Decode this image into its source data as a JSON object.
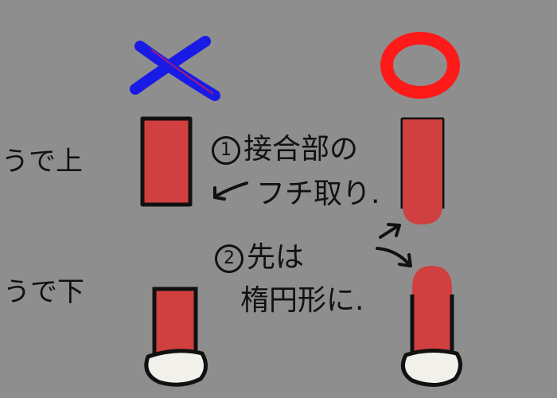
{
  "labels": {
    "upper_arm": "うで上",
    "lower_arm": "うで下"
  },
  "notes": {
    "note1": {
      "number": "1",
      "line1": "接合部の",
      "line2": "フチ取り."
    },
    "note2": {
      "number": "2",
      "line1": "先は",
      "line2": "楕円形に."
    }
  },
  "colors": {
    "background": "#8e8e8e",
    "arm_red": "#d04040",
    "cuff_white": "#f2f0ea",
    "outline": "#111111",
    "bad_mark": "#1a1ae6",
    "good_mark": "#ff1a1a"
  },
  "icons": {
    "bad": "x-mark-icon",
    "good": "circle-mark-icon"
  }
}
